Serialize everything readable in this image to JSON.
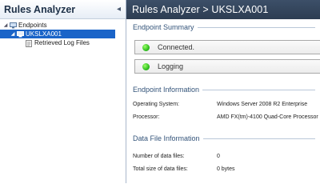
{
  "left_pane": {
    "title": "Rules Analyzer",
    "collapse_glyph": "◂",
    "tree": [
      {
        "label": "Endpoints",
        "expander": "◢",
        "icon": "endpoints-icon"
      },
      {
        "label": "UKSLXA001",
        "expander": "◢",
        "icon": "computer-icon",
        "selected": true
      },
      {
        "label": "Retrieved Log Files",
        "icon": "log-files-icon"
      }
    ]
  },
  "main": {
    "breadcrumb": "Rules Analyzer > UKSLXA001",
    "endpoint_summary": {
      "title": "Endpoint Summary",
      "status_items": [
        {
          "label": "Connected.",
          "color": "#2fbf1f"
        },
        {
          "label": "Logging",
          "color": "#2fbf1f"
        }
      ]
    },
    "endpoint_information": {
      "title": "Endpoint Information",
      "rows": [
        {
          "key": "Operating System:",
          "value": "Windows Server 2008 R2 Enterprise"
        },
        {
          "key": "Processor:",
          "value": "AMD FX(tm)-4100 Quad-Core Processor"
        }
      ]
    },
    "data_file_information": {
      "title": "Data File Information",
      "rows": [
        {
          "key": "Number of data files:",
          "value": "0"
        },
        {
          "key": "Total size of data files:",
          "value": "0 bytes"
        }
      ]
    }
  },
  "colors": {
    "header_bg": "#2d3d52",
    "selection": "#1a64c8",
    "section_title": "#34547a",
    "status_green": "#2fbf1f"
  }
}
